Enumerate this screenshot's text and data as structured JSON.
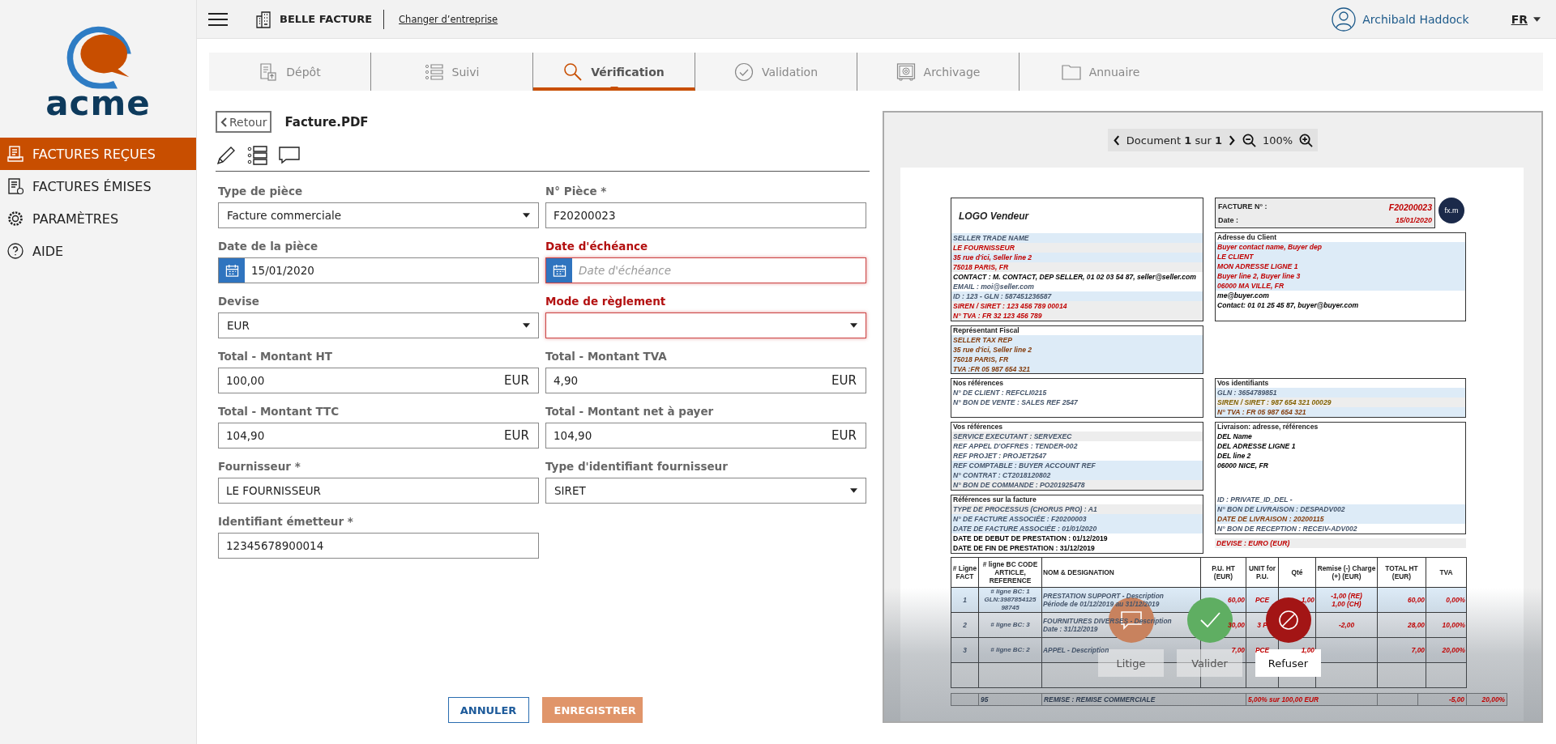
{
  "header": {
    "company": "BELLE FACTURE",
    "change_link": "Changer d’entreprise",
    "user": "Archibald Haddock",
    "language": "FR"
  },
  "sidebar": {
    "logo_text": "acme",
    "items": [
      {
        "label": "FACTURES REÇUES",
        "selected": true
      },
      {
        "label": "FACTURES ÉMISES",
        "selected": false
      },
      {
        "label": "PARAMÈTRES",
        "selected": false
      },
      {
        "label": "AIDE",
        "selected": false
      }
    ]
  },
  "tabs": [
    {
      "label": "Dépôt",
      "selected": false
    },
    {
      "label": "Suivi",
      "selected": false
    },
    {
      "label": "Vérification",
      "selected": true
    },
    {
      "label": "Validation",
      "selected": false
    },
    {
      "label": "Archivage",
      "selected": false
    },
    {
      "label": "Annuaire",
      "selected": false
    }
  ],
  "form": {
    "back": "Retour",
    "file_name": "Facture.PDF",
    "fields": [
      {
        "label": "Type de pièce",
        "kind": "select",
        "value": "Facture commerciale",
        "error": false
      },
      {
        "label": "N° Pièce *",
        "kind": "text",
        "value": "F20200023",
        "error": false
      },
      {
        "label": "Date de la pièce",
        "kind": "date",
        "value": "15/01/2020",
        "error": false
      },
      {
        "label": "Date d'échéance",
        "kind": "date",
        "placeholder": "Date d'échéance",
        "error": true
      },
      {
        "label": "Devise",
        "kind": "select",
        "value": "EUR",
        "error": false
      },
      {
        "label": "Mode de règlement",
        "kind": "select",
        "error": true
      },
      {
        "label": "Total - Montant HT",
        "kind": "amount",
        "value": "100,00",
        "unit": "EUR",
        "error": false
      },
      {
        "label": "Total - Montant TVA",
        "kind": "amount",
        "value": "4,90",
        "unit": "EUR",
        "error": false
      },
      {
        "label": "Total - Montant TTC",
        "kind": "amount",
        "value": "104,90",
        "unit": "EUR",
        "error": false
      },
      {
        "label": "Total - Montant net à payer",
        "kind": "amount",
        "value": "104,90",
        "unit": "EUR",
        "error": false
      },
      {
        "label": "Fournisseur *",
        "kind": "text",
        "value": "LE FOURNISSEUR",
        "error": false
      },
      {
        "label": "Type d'identifiant fournisseur",
        "kind": "select",
        "value": "SIRET",
        "error": false
      },
      {
        "label": "Identifiant émetteur *",
        "kind": "text",
        "value": "12345678900014",
        "error": false
      }
    ],
    "buttons": {
      "cancel": "ANNULER",
      "save": "ENREGISTRER"
    }
  },
  "viewer": {
    "pager": "Document **1** sur **1**",
    "zoom": "100%",
    "invoice": {
      "seller": {
        "logo": "LOGO Vendeur",
        "lines": [
          {
            "text": "SELLER TRADE NAME",
            "color": "#44546a",
            "kind": "blue"
          },
          {
            "text": "LE FOURNISSEUR",
            "color": "#c00000",
            "kind": "grey"
          },
          {
            "text": "35 rue d'ici, Seller line 2",
            "color": "#c00000",
            "kind": "blue"
          },
          {
            "text": "75018 PARIS, FR",
            "color": "#c00000",
            "kind": "grey"
          },
          {
            "text": "CONTACT : M. CONTACT, DEP SELLER, 01 02 03 54 87, seller@seller.com",
            "color": "#000000"
          },
          {
            "text": "EMAIL : moi@seller.com",
            "color": "#44546a"
          },
          {
            "text": "ID : 123 - GLN : 587451236587",
            "color": "#44546a",
            "kind": "blue"
          },
          {
            "text": "SIREN / SIRET : 123 456 789 00014",
            "color": "#c00000",
            "kind": "grey"
          },
          {
            "text": "N° TVA : FR 32 123 456 789",
            "color": "#c00000",
            "kind": "grey"
          }
        ]
      },
      "number": {
        "label": "FACTURE N° :",
        "value": "F20200023",
        "date_label": "Date :",
        "date": "15/01/2020",
        "logo_mark": "fx.m"
      },
      "client": {
        "title": "Adresse du Client",
        "lines": [
          {
            "text": "Buyer contact name, Buyer dep",
            "color": "#c00000",
            "kind": "blue"
          },
          {
            "text": "LE CLIENT",
            "color": "#c00000",
            "kind": "blue"
          },
          {
            "text": "MON ADRESSE LIGNE 1",
            "color": "#c00000",
            "kind": "blue"
          },
          {
            "text": "Buyer line 2, Buyer line 3",
            "color": "#c00000",
            "kind": "blue"
          },
          {
            "text": "06000 MA VILLE, FR",
            "color": "#c00000",
            "kind": "blue"
          },
          {
            "text": "me@buyer.com",
            "color": "#000000"
          },
          {
            "text": "Contact: 01 01 25 45 87, buyer@buyer.com",
            "color": "#000000"
          }
        ]
      },
      "fiscal_rep": {
        "title": "Représentant Fiscal",
        "lines": [
          {
            "text": "SELLER TAX REP",
            "color": "#843c0c",
            "kind": "blue"
          },
          {
            "text": "35 rue d'ici, Seller line 2",
            "color": "#843c0c",
            "kind": "blue"
          },
          {
            "text": "75018 PARIS, FR",
            "color": "#843c0c",
            "kind": "blue"
          },
          {
            "text": "TVA :FR 05 987 654 321",
            "color": "#843c0c",
            "kind": "blue"
          }
        ]
      },
      "our_refs": {
        "title": "Nos références",
        "lines": [
          {
            "text": "N° DE CLIENT : REFCLI0215",
            "color": "#44546a"
          },
          {
            "text": "N° BON DE VENTE : SALES REF 2547",
            "color": "#44546a"
          }
        ]
      },
      "your_ids": {
        "title": "Vos identifiants",
        "lines": [
          {
            "text": "GLN : 3654789851",
            "color": "#44546a",
            "kind": "blue"
          },
          {
            "text": "SIREN / SIRET : 987 654 321 00029",
            "color": "#806000",
            "kind": "grey"
          },
          {
            "text": "N° TVA : FR 05 987 654 321",
            "color": "#843c0c",
            "kind": "blue"
          }
        ]
      },
      "your_refs": {
        "title": "Vos références",
        "lines": [
          {
            "text": "SERVICE EXECUTANT : SERVEXEC",
            "color": "#44546a",
            "kind": "grey"
          },
          {
            "text": "REF APPEL D'OFFRES : TENDER-002",
            "color": "#44546a"
          },
          {
            "text": "REF PROJET : PROJET2547",
            "color": "#44546a"
          },
          {
            "text": "REF COMPTABLE : BUYER ACCOUNT REF",
            "color": "#44546a",
            "kind": "blue"
          },
          {
            "text": "N° CONTRAT : CT2018120802",
            "color": "#44546a",
            "kind": "blue"
          },
          {
            "text": "N° BON DE COMMANDE : PO201925478",
            "color": "#44546a",
            "kind": "grey"
          }
        ]
      },
      "invoice_refs": {
        "title": "Références sur la facture",
        "lines": [
          {
            "text": "TYPE DE PROCESSUS (CHORUS PRO) : A1",
            "color": "#44546a",
            "kind": "grey"
          },
          {
            "text": "N° DE FACTURE ASSOCIÉE : F20200003",
            "color": "#44546a",
            "kind": "blue"
          },
          {
            "text": "DATE DE FACTURE ASSOCIÉE : 01/01/2020",
            "color": "#44546a",
            "kind": "blue"
          },
          {
            "text": "DATE DE DEBUT DE PRESTATION : 01/12/2019",
            "color": "#000000",
            "plain": true
          },
          {
            "text": "DATE DE FIN DE PRESTATION : 31/12/2019",
            "color": "#000000",
            "plain": true
          }
        ]
      },
      "delivery": {
        "title": "Livraison: adresse, références",
        "lines": [
          {
            "text": "DEL Name",
            "color": "#000000"
          },
          {
            "text": "DEL ADRESSE LIGNE 1",
            "color": "#000000"
          },
          {
            "text": "DEL line 2",
            "color": "#000000"
          },
          {
            "text": "06000 NICE, FR",
            "color": "#000000"
          }
        ],
        "lines_bottom": [
          {
            "text": "ID : PRIVATE_ID_DEL -",
            "color": "#44546a"
          },
          {
            "text": "N° BON DE LIVRAISON : DESPADV002",
            "color": "#44546a",
            "kind": "blue"
          },
          {
            "text": "DATE DE LIVRAISON : 20200115",
            "color": "#843c0c",
            "kind": "blue"
          },
          {
            "text": "N° BON DE RECEPTION : RECEIV-ADV002",
            "color": "#44546a"
          }
        ]
      },
      "currency": "DEVISE : EURO (EUR)",
      "table": {
        "columns": [
          "# Ligne FACT",
          "# ligne BC CODE ARTICLE, REFERENCE",
          "NOM & DESIGNATION",
          "P.U. HT (EUR)",
          "UNIT for P.U.",
          "Qté",
          "Remise (-) Charge (+) (EUR)",
          "TOTAL HT (EUR)",
          "TVA"
        ],
        "rows": [
          {
            "line": "1",
            "ref": [
              "# ligne BC: 1",
              "GLN:3987854125",
              "98745"
            ],
            "name": [
              "PRESTATION SUPPORT - Description",
              "Période de 01/12/2019 au 31/12/2019"
            ],
            "unit_price": "60,00",
            "unit": "PCE",
            "qty": "1,00",
            "adjust": [
              "-1,00 (RE)",
              "1,00 (CH)"
            ],
            "total": "60,00",
            "vat": "0,00%"
          },
          {
            "line": "2",
            "ref": [
              "# ligne BC: 3"
            ],
            "name": [
              "FOURNITURES DIVERSES - Description",
              "Date : 31/12/2019"
            ],
            "unit_price": "30,00",
            "unit": "3 P",
            "adjust": [
              "-2,00"
            ],
            "total": "28,00",
            "vat": "10,00%"
          },
          {
            "line": "3",
            "ref": [
              "# ligne BC: 2"
            ],
            "name": [
              "APPEL - Description"
            ],
            "unit_price": "7,00",
            "unit": "PCE",
            "qty": "1,00",
            "total": "7,00",
            "vat": "20,00%"
          }
        ],
        "discount_row": {
          "ref": "95",
          "name": "REMISE : REMISE COMMERCIALE",
          "basis": "5,00% sur 100,00 EUR",
          "total": "-5,00",
          "vat": "20,00%"
        }
      }
    },
    "actions": [
      {
        "label": "Litige",
        "kind": "dispute",
        "color": "#c8825e",
        "selected": false
      },
      {
        "label": "Valider",
        "kind": "validate",
        "color": "#5fae62",
        "selected": false
      },
      {
        "label": "Refuser",
        "kind": "refuse",
        "color": "#a31515",
        "selected": true
      }
    ]
  }
}
